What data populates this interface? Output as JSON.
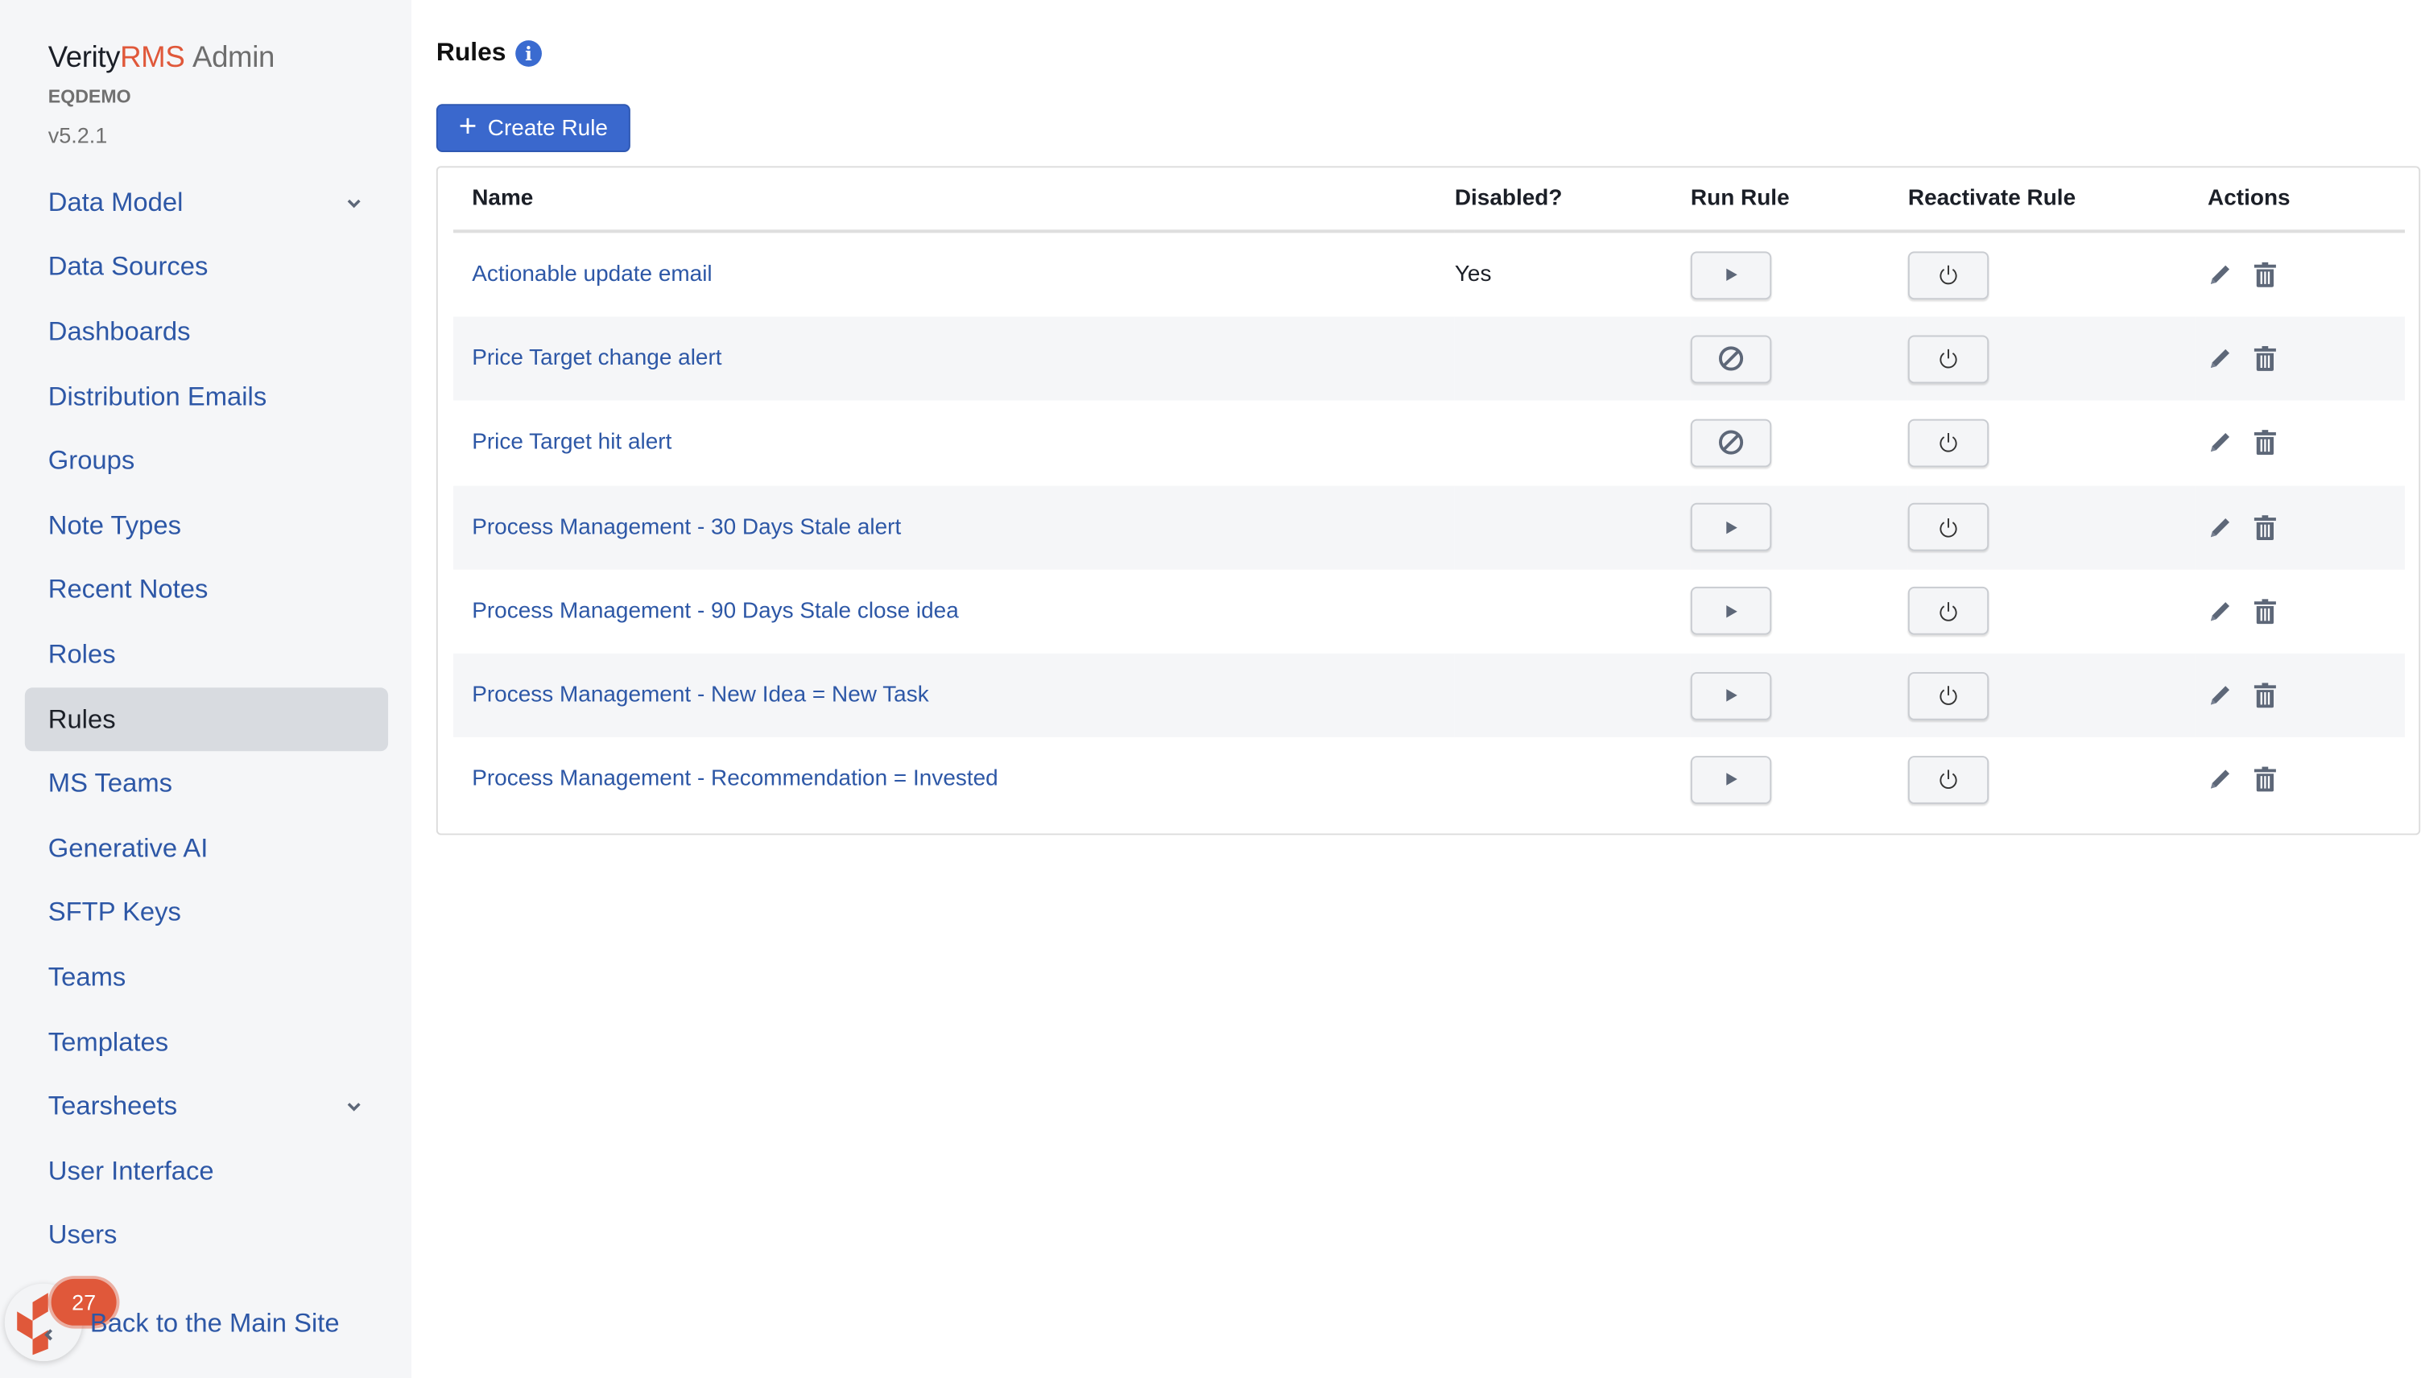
{
  "sidebar": {
    "brand": {
      "part1": "Verity",
      "part2": "RMS",
      "part3": "Admin"
    },
    "tenant": "EQDEMO",
    "version": "v5.2.1",
    "items": [
      {
        "label": "Data Model",
        "expandable": true
      },
      {
        "label": "Data Sources"
      },
      {
        "label": "Dashboards"
      },
      {
        "label": "Distribution Emails"
      },
      {
        "label": "Groups"
      },
      {
        "label": "Note Types"
      },
      {
        "label": "Recent Notes"
      },
      {
        "label": "Roles"
      },
      {
        "label": "Rules",
        "active": true
      },
      {
        "label": "MS Teams"
      },
      {
        "label": "Generative AI"
      },
      {
        "label": "SFTP Keys"
      },
      {
        "label": "Teams"
      },
      {
        "label": "Templates"
      },
      {
        "label": "Tearsheets",
        "expandable": true
      },
      {
        "label": "User Interface"
      },
      {
        "label": "Users"
      }
    ],
    "back_link": "Back to the Main Site",
    "notification_count": "27"
  },
  "main": {
    "title": "Rules",
    "create_button": "Create Rule",
    "table": {
      "headers": [
        "Name",
        "Disabled?",
        "Run Rule",
        "Reactivate Rule",
        "Actions"
      ],
      "rows": [
        {
          "name": "Actionable update email",
          "disabled": "Yes",
          "run_icon": "play-icon"
        },
        {
          "name": "Price Target change alert",
          "disabled": "",
          "run_icon": "ban-icon"
        },
        {
          "name": "Price Target hit alert",
          "disabled": "",
          "run_icon": "ban-icon"
        },
        {
          "name": "Process Management - 30 Days Stale alert",
          "disabled": "",
          "run_icon": "play-icon"
        },
        {
          "name": "Process Management - 90 Days Stale close idea",
          "disabled": "",
          "run_icon": "play-icon"
        },
        {
          "name": "Process Management - New Idea = New Task",
          "disabled": "",
          "run_icon": "play-icon"
        },
        {
          "name": "Process Management - Recommendation = Invested",
          "disabled": "",
          "run_icon": "play-icon"
        }
      ]
    }
  },
  "colors": {
    "accent": "#3a68cd",
    "brand_orange": "#e0583a",
    "link": "#2d57a6",
    "icon_gray": "#5d6778"
  }
}
